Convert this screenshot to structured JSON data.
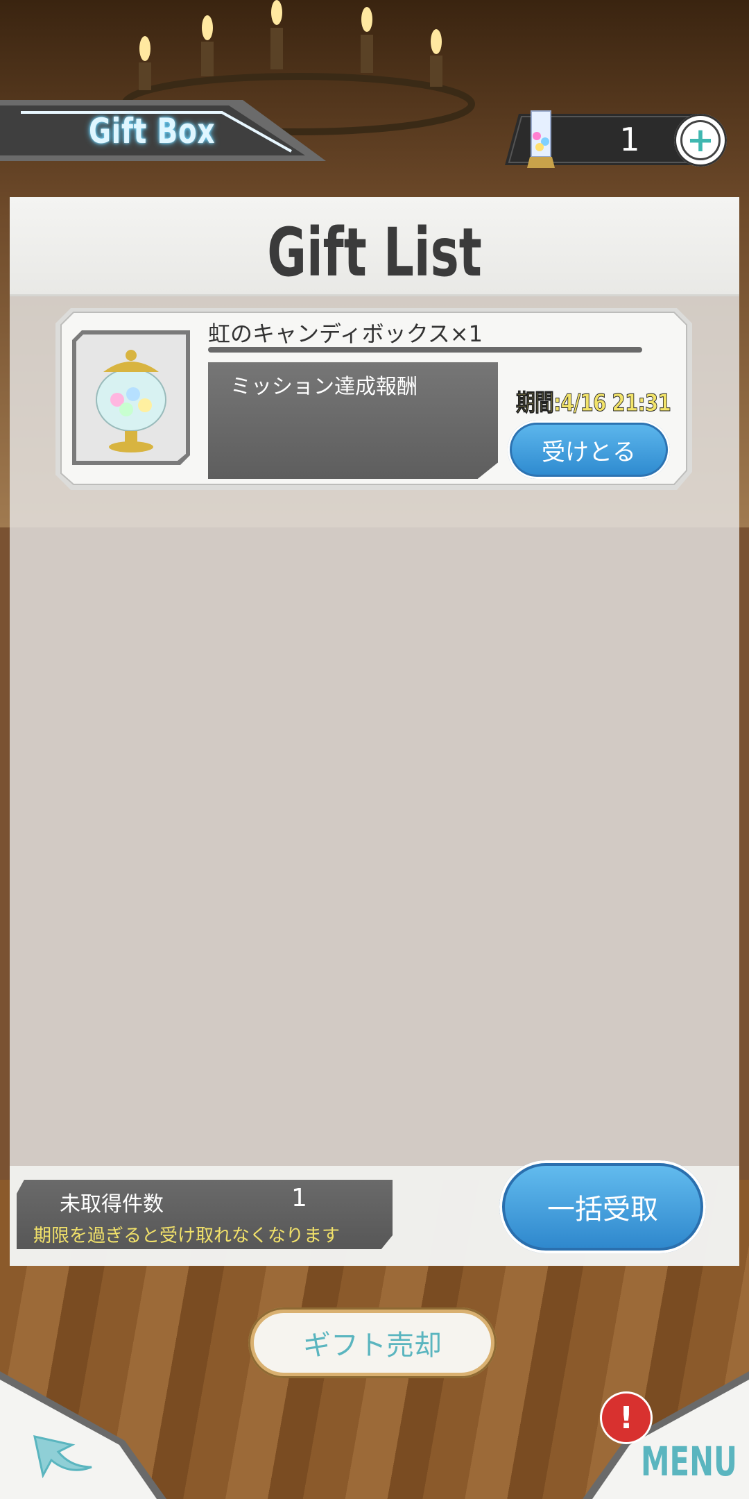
{
  "header": {
    "title": "Gift Box",
    "currency_count": "1",
    "add_currency_icon": "plus-icon"
  },
  "panel": {
    "title": "Gift List"
  },
  "gift_items": [
    {
      "name": "虹のキャンディボックス×1",
      "description": "ミッション達成報酬",
      "expiry": "期間:4/16 21:31",
      "receive_label": "受けとる",
      "icon": "candy-jar-icon"
    }
  ],
  "summary": {
    "unclaimed_label": "未取得件数",
    "unclaimed_count": "1",
    "warning": "期限を過ぎると受け取れなくなります",
    "bulk_receive_label": "一括受取"
  },
  "sell_button_label": "ギフト売却",
  "nav": {
    "back_icon": "back-arrow-icon",
    "menu_label": "MENU",
    "alert_badge": "!"
  },
  "colors": {
    "accent_blue": "#2f8bd0",
    "teal_text": "#5ab5bf",
    "warning_yellow": "#f1e16a",
    "alert_red": "#d8312f"
  }
}
